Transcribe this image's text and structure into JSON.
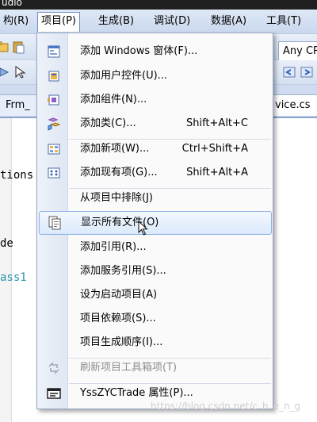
{
  "window": {
    "title": "udio"
  },
  "menubar": {
    "items": [
      {
        "label": "构(R)"
      },
      {
        "label": "项目(P)"
      },
      {
        "label": "生成(B)"
      },
      {
        "label": "调试(D)"
      },
      {
        "label": "数据(A)"
      },
      {
        "label": "工具(T)"
      }
    ]
  },
  "toolbar": {
    "config_combo": "Any CPU"
  },
  "tabs": {
    "left": "Frm_",
    "right": "vice.cs"
  },
  "code": {
    "lines": [
      "tions",
      "de",
      "ass1"
    ]
  },
  "menu": {
    "items": [
      {
        "label": "添加 Windows 窗体(F)...",
        "shortcut": "",
        "icon": "add-windows-form-icon"
      },
      {
        "label": "添加用户控件(U)...",
        "shortcut": "",
        "icon": "add-user-control-icon"
      },
      {
        "label": "添加组件(N)...",
        "shortcut": "",
        "icon": "add-component-icon"
      },
      {
        "label": "添加类(C)...",
        "shortcut": "Shift+Alt+C",
        "icon": "add-class-icon"
      },
      {
        "label": "添加新项(W)...",
        "shortcut": "Ctrl+Shift+A",
        "icon": "add-new-item-icon"
      },
      {
        "label": "添加现有项(G)...",
        "shortcut": "Shift+Alt+A",
        "icon": "add-existing-item-icon"
      },
      {
        "label": "从项目中排除(J)",
        "shortcut": "",
        "icon": ""
      },
      {
        "label": "显示所有文件(O)",
        "shortcut": "",
        "icon": "show-all-files-icon"
      },
      {
        "label": "添加引用(R)...",
        "shortcut": "",
        "icon": ""
      },
      {
        "label": "添加服务引用(S)...",
        "shortcut": "",
        "icon": ""
      },
      {
        "label": "设为启动项目(A)",
        "shortcut": "",
        "icon": ""
      },
      {
        "label": "项目依赖项(S)...",
        "shortcut": "",
        "icon": ""
      },
      {
        "label": "项目生成顺序(I)...",
        "shortcut": "",
        "icon": ""
      },
      {
        "label": "刷新项目工具箱项(T)",
        "shortcut": "",
        "icon": "refresh-toolbox-icon"
      },
      {
        "label": "YssZYCTrade 属性(P)...",
        "shortcut": "",
        "icon": "properties-icon"
      }
    ]
  },
  "watermark": "https://blog.csdn.net/c_h_e_n_g"
}
